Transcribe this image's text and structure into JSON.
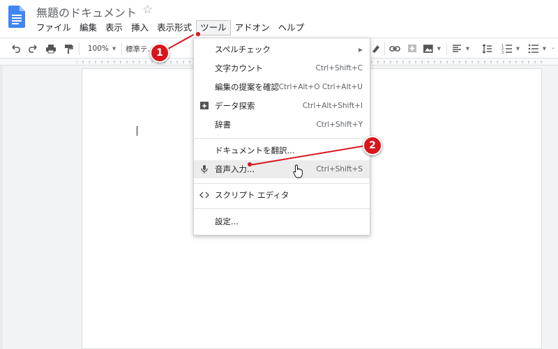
{
  "document": {
    "title": "無題のドキュメント",
    "star_glyph": "☆"
  },
  "menubar": [
    "ファイル",
    "編集",
    "表示",
    "挿入",
    "表示形式",
    "ツール",
    "アドオン",
    "ヘルプ"
  ],
  "toolbar": {
    "zoom": "100%",
    "style": "標準テ..."
  },
  "tools_menu": {
    "items": [
      {
        "label": "スペルチェック",
        "shortcut": "",
        "submenu": true
      },
      {
        "label": "文字カウント",
        "shortcut": "Ctrl+Shift+C"
      },
      {
        "label": "編集の提案を確認",
        "shortcut": "Ctrl+Alt+O Ctrl+Alt+U"
      },
      {
        "label": "データ探索",
        "shortcut": "Ctrl+Alt+Shift+I",
        "icon": "explore-icon"
      },
      {
        "label": "辞書",
        "shortcut": "Ctrl+Shift+Y"
      },
      {
        "label": "ドキュメントを翻訳...",
        "shortcut": ""
      },
      {
        "label": "音声入力...",
        "shortcut": "Ctrl+Shift+S",
        "icon": "microphone-icon",
        "hovered": true
      },
      {
        "label": "スクリプト エディタ",
        "shortcut": "",
        "icon": "code-icon"
      },
      {
        "label": "設定...",
        "shortcut": ""
      }
    ]
  },
  "annotations": [
    {
      "label": "1"
    },
    {
      "label": "2"
    }
  ],
  "colors": {
    "annotation": "#d9141c",
    "docs_blue": "#4285f4"
  }
}
